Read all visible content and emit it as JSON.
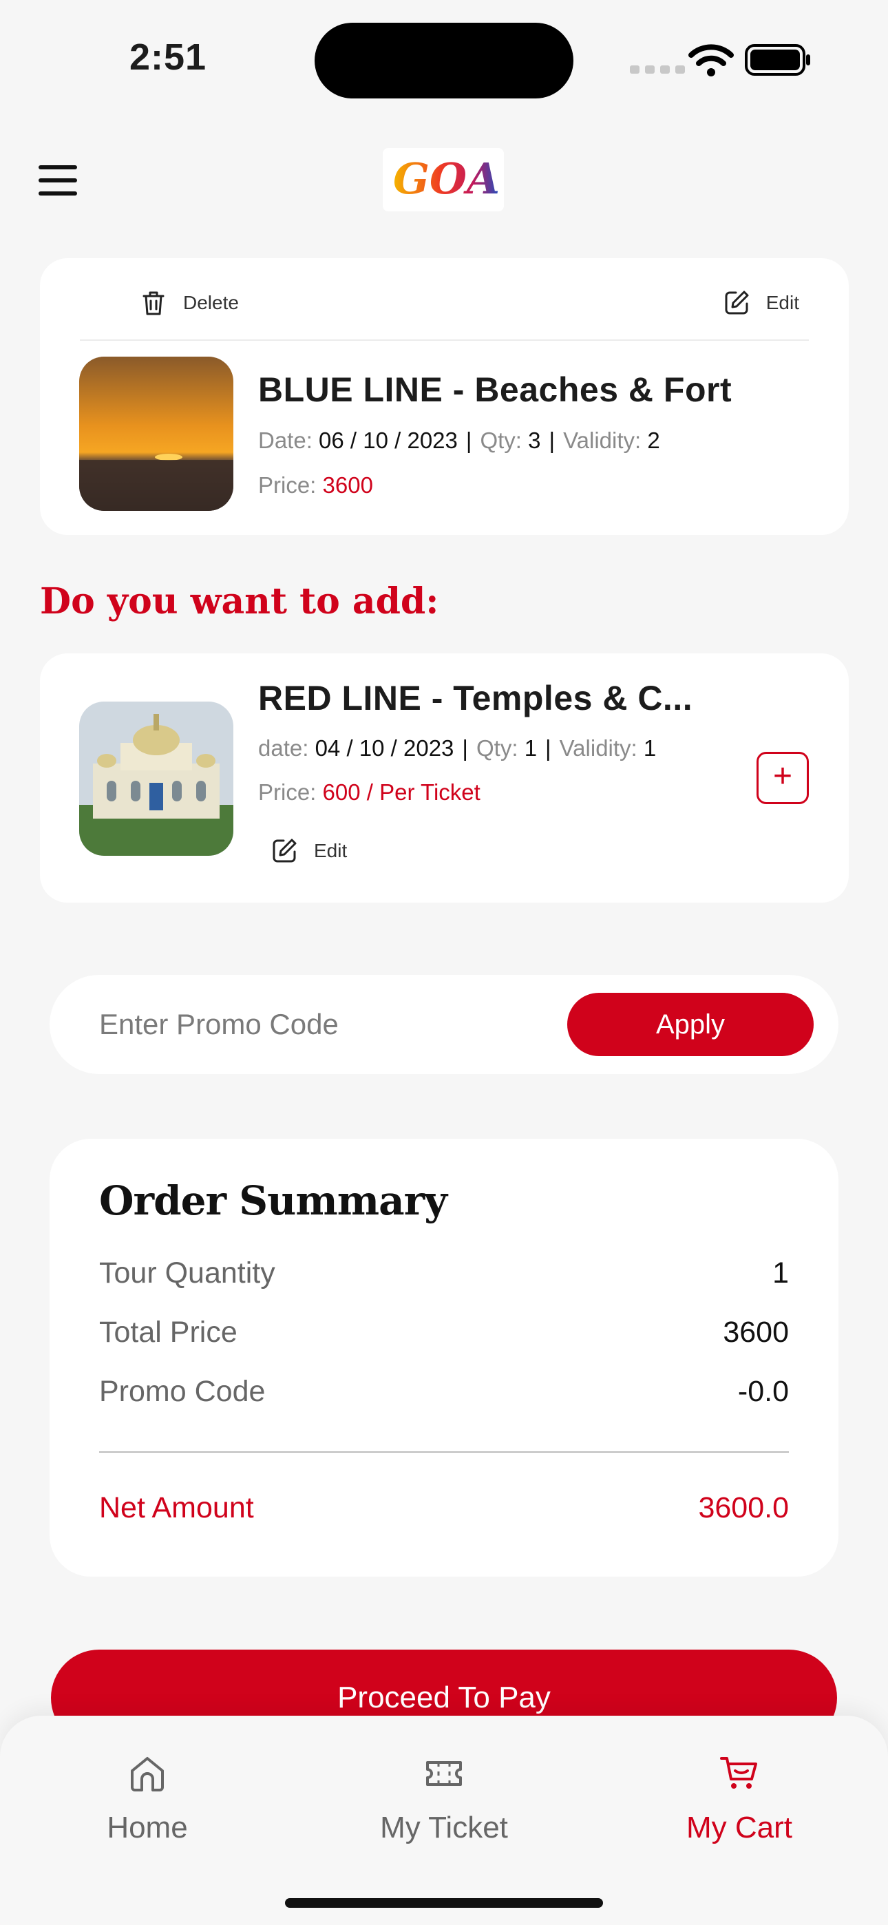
{
  "status_bar": {
    "time": "2:51"
  },
  "header": {
    "logo_text": "GOA"
  },
  "cart_item": {
    "delete_label": "Delete",
    "edit_label": "Edit",
    "title": "BLUE LINE - Beaches & Fort",
    "date_label": "Date:",
    "date": "06 / 10 / 2023",
    "qty_label": "Qty:",
    "qty": "3",
    "validity_label": "Validity:",
    "validity": "2",
    "price_label": "Price:",
    "price": "3600"
  },
  "add_section": {
    "heading": "Do you want to add:"
  },
  "suggestion": {
    "title": "RED LINE - Temples & C...",
    "date_label": "date:",
    "date": "04 / 10 / 2023",
    "qty_label": "Qty:",
    "qty": "1",
    "validity_label": "Validity:",
    "validity": "1",
    "price_label": "Price:",
    "price": "600 / Per Ticket",
    "edit_label": "Edit",
    "add_symbol": "+"
  },
  "promo": {
    "placeholder": "Enter Promo Code",
    "apply_label": "Apply"
  },
  "order_summary": {
    "title": "Order Summary",
    "rows": [
      {
        "label": "Tour Quantity",
        "value": "1"
      },
      {
        "label": "Total Price",
        "value": "3600"
      },
      {
        "label": "Promo Code",
        "value": "-0.0"
      }
    ],
    "net_label": "Net Amount",
    "net_value": "3600.0"
  },
  "proceed_label": "Proceed To Pay",
  "tabs": [
    {
      "label": "Home",
      "icon": "home-icon"
    },
    {
      "label": "My Ticket",
      "icon": "ticket-icon"
    },
    {
      "label": "My Cart",
      "icon": "cart-icon",
      "active": true
    }
  ],
  "colors": {
    "accent": "#d0021b",
    "background": "#f6f6f6"
  }
}
